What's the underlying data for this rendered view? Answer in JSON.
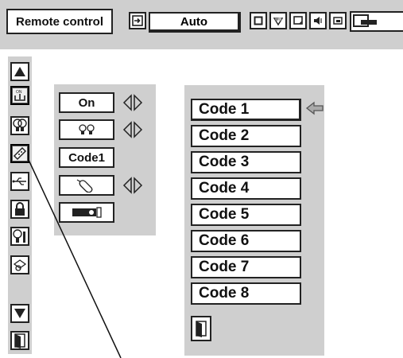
{
  "topbar": {
    "title": "Remote control",
    "input_mode": "Auto",
    "icons": [
      "input-icon",
      "image-adjust-icon",
      "color-icon",
      "screen-icon",
      "sound-icon",
      "setting-icon"
    ]
  },
  "left_menu": {
    "icons": [
      "up-arrow-icon",
      "on-off-icon",
      "lamp-icon",
      "remote-icon",
      "usb-icon",
      "lock-icon",
      "lamp-counter-icon",
      "projector-setting-icon",
      "down-arrow-icon",
      "exit-icon"
    ],
    "selected": "remote-icon"
  },
  "sub_panel": {
    "power_value": "On",
    "lamp_icon": "lamp-icon",
    "remote_value": "Code1",
    "mouse_icon": "mouse-icon",
    "projector_icon": "projector-icon"
  },
  "code_list": {
    "items": [
      "Code 1",
      "Code 2",
      "Code 3",
      "Code 4",
      "Code 5",
      "Code 6",
      "Code 7",
      "Code 8"
    ],
    "selected_index": 0,
    "exit_icon": "exit-icon"
  }
}
